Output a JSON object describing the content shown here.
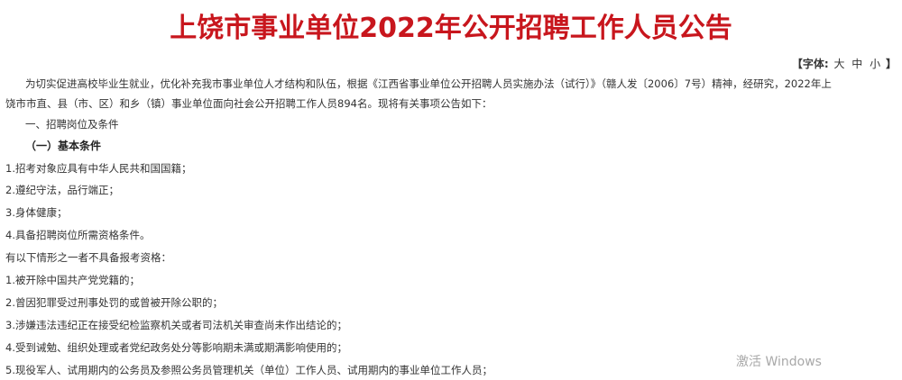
{
  "title": "上饶市事业单位2022年公开招聘工作人员公告",
  "font_size_tool": {
    "prefix": "【字体:",
    "options": [
      "大",
      "中",
      "小"
    ],
    "suffix": "】"
  },
  "intro": {
    "line1": "为切实促进高校毕业生就业，优化补充我市事业单位人才结构和队伍，根据《江西省事业单位公开招聘人员实施办法（试行）》（赣人发〔2006〕7号）精神，经研究，2022年上",
    "line2": "饶市市直、县（市、区）和乡（镇）事业单位面向社会公开招聘工作人员894名。现将有关事项公告如下："
  },
  "section1": "一、招聘岗位及条件",
  "subsection1": "（一）基本条件",
  "basic_conditions": [
    "1.招考对象应具有中华人民共和国国籍；",
    "2.遵纪守法，品行端正；",
    "3.身体健康；",
    "4.具备招聘岗位所需资格条件。"
  ],
  "exclusion_intro": "有以下情形之一者不具备报考资格：",
  "exclusions": [
    "1.被开除中国共产党党籍的；",
    "2.曾因犯罪受过刑事处罚的或曾被开除公职的；",
    "3.涉嫌违法违纪正在接受纪检监察机关或者司法机关审查尚未作出结论的；",
    "4.受到诫勉、组织处理或者党纪政务处分等影响期未满或期满影响使用的；",
    "5.现役军人、试用期内的公务员及参照公务员管理机关（单位）工作人员、试用期内的事业单位工作人员；"
  ],
  "watermark": "激活 Windows"
}
